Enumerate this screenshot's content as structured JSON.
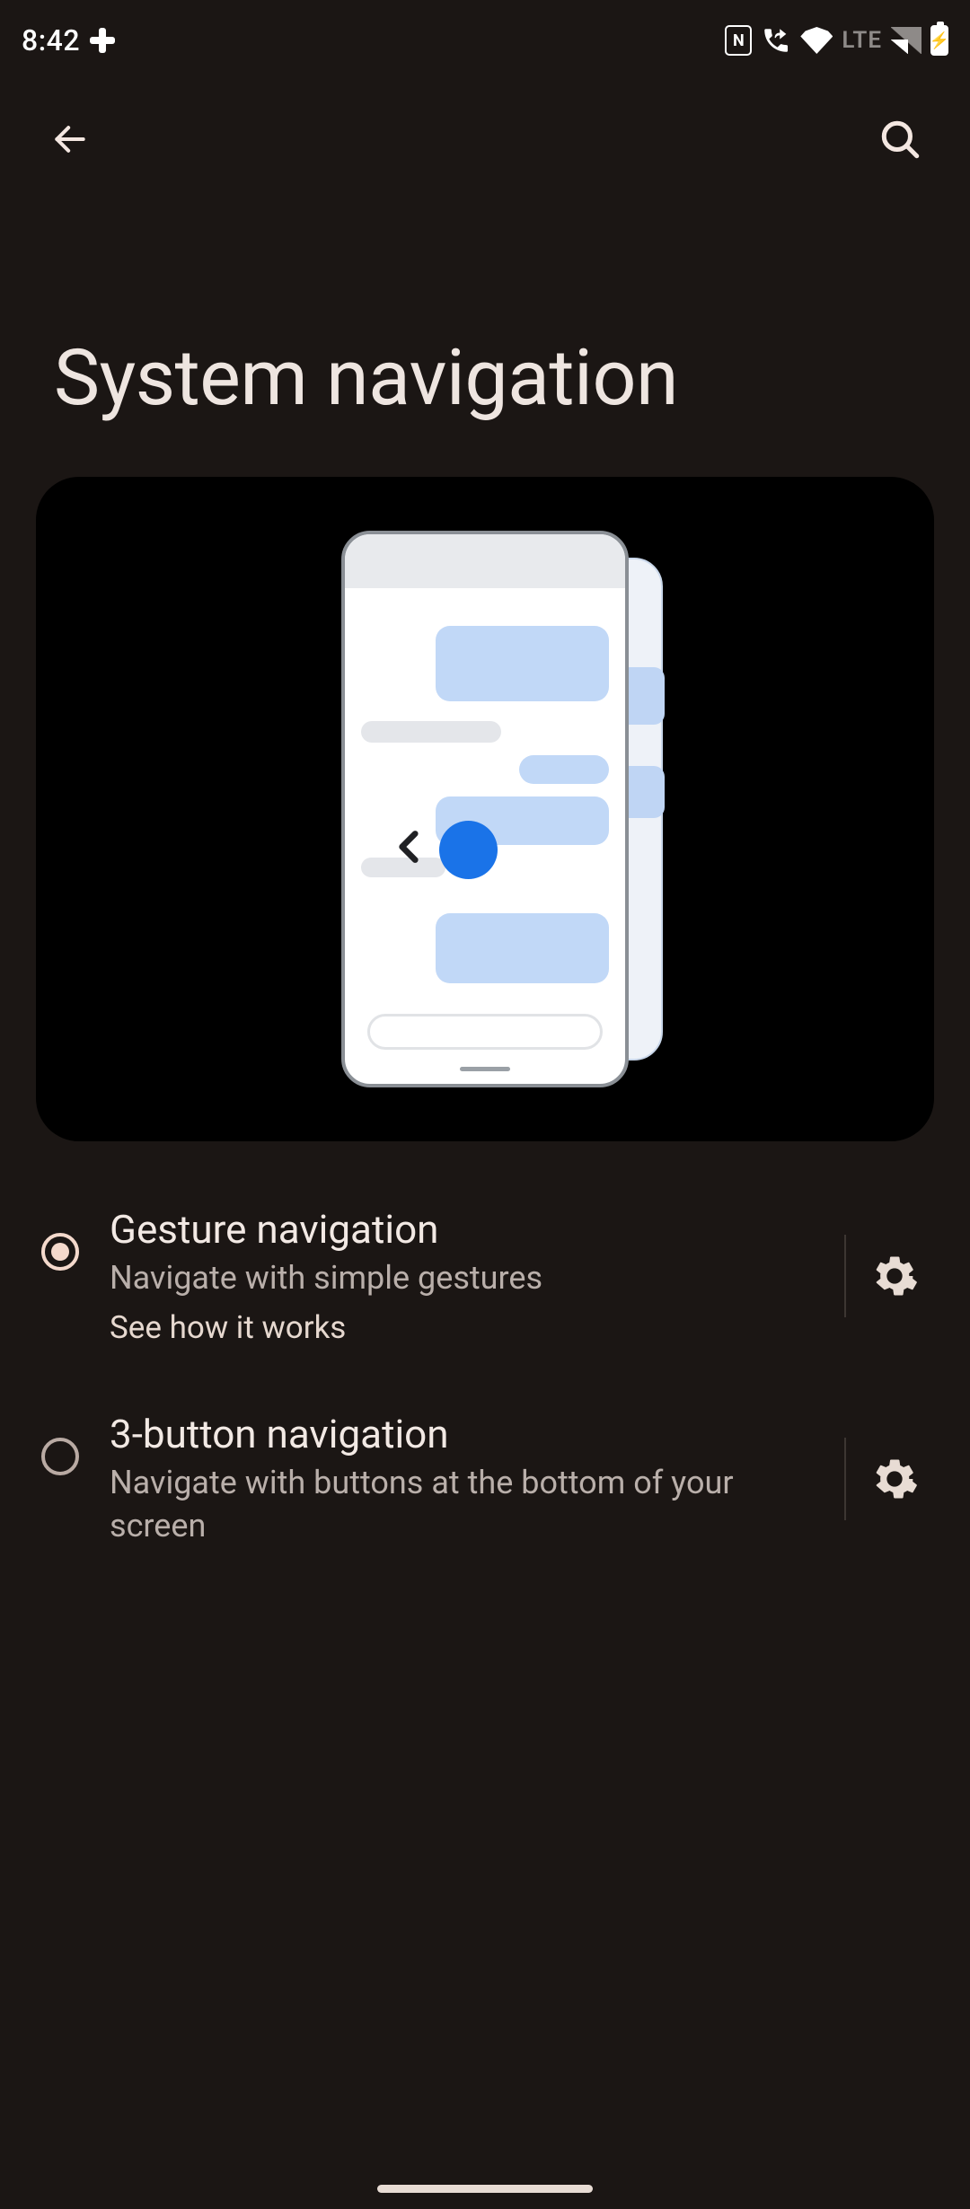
{
  "status": {
    "time": "8:42",
    "lte": "LTE",
    "nfc": "N"
  },
  "appbar": {
    "back_label": "Back",
    "search_label": "Search"
  },
  "page": {
    "title": "System navigation"
  },
  "options": [
    {
      "key": "gesture",
      "title": "Gesture navigation",
      "subtitle": "Navigate with simple gestures",
      "link": "See how it works",
      "selected": true
    },
    {
      "key": "three_button",
      "title": "3-button navigation",
      "subtitle": "Navigate with buttons at the bottom of your screen",
      "link": "",
      "selected": false
    }
  ]
}
